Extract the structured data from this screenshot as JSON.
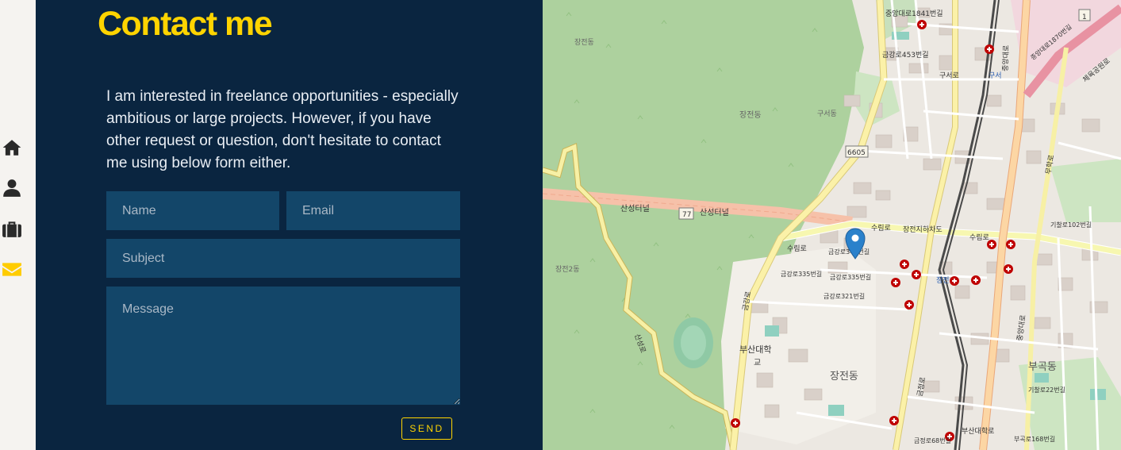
{
  "sidebar": {
    "items": [
      {
        "id": "home",
        "icon": "home-icon"
      },
      {
        "id": "about",
        "icon": "user-icon"
      },
      {
        "id": "portfolio",
        "icon": "briefcase-icon"
      },
      {
        "id": "contact",
        "icon": "envelope-icon",
        "active": true
      }
    ],
    "accent_color": "#ffcc00"
  },
  "contact": {
    "title": "Contact me",
    "intro": "I am interested in freelance opportunities - especially ambitious or large projects. However, if you have other request or question, don't hesitate to contact me using below form either.",
    "form": {
      "name_placeholder": "Name",
      "email_placeholder": "Email",
      "subject_placeholder": "Subject",
      "message_placeholder": "Message",
      "send_label": "SEND"
    },
    "colors": {
      "background": "#0a2540",
      "field": "#134669",
      "title": "#ffd400"
    }
  },
  "map": {
    "pin_icon": "map-marker-icon",
    "labels": {
      "road_1841": "중앙대로1841번길",
      "road_453": "금강로453번길",
      "gusoro": "구서로",
      "guseo_station": "구서",
      "jangjeon_dong_north": "장전동",
      "jangjeon_dong_top": "장전동",
      "guseo_dong": "구서동",
      "tunnel_left": "산성터널",
      "tunnel_right": "산성터널",
      "route_77": "77",
      "route_6605": "6605",
      "suryong_ro_1": "수림로",
      "suryong_ro_2": "수림로",
      "suryong_ro_3": "수림로",
      "jangjeon_underpass": "장전지하차도",
      "jangjeon_2_dong": "장전2동",
      "road_345": "금강로345번길",
      "road_335a": "금강로335번길",
      "road_335b": "금강로335번길",
      "road_321": "금강로321번길",
      "pnu": "부산대학",
      "pnu_gate": "교",
      "jangjeon_dong": "장전동",
      "jangjeon_station": "장전",
      "bugok_dong": "부곡동",
      "pnu_station": "부산대학로",
      "bugok_168": "부곡로168번길",
      "gijang_22": "기찰로22번길",
      "geumgang_68": "금정로68번길",
      "sanseong": "산성로",
      "geumgang_ro": "금강로",
      "geumjeong_ro": "금정로",
      "jungang_daero_1": "중앙대로",
      "jungang_daero_2": "중앙대로",
      "muhak_ro": "무학로",
      "stadium": "체육공원로",
      "jungang_1870": "중앙대로1870번길",
      "gijang_102": "기찰로102번길",
      "route_1": "1"
    }
  }
}
